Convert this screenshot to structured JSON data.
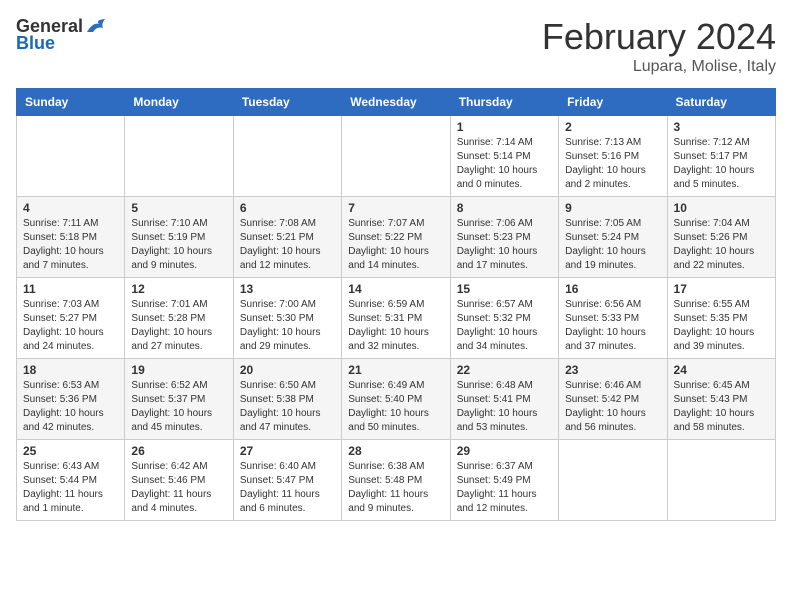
{
  "header": {
    "logo": {
      "general": "General",
      "blue": "Blue"
    },
    "title": "February 2024",
    "location": "Lupara, Molise, Italy"
  },
  "calendar": {
    "weekdays": [
      "Sunday",
      "Monday",
      "Tuesday",
      "Wednesday",
      "Thursday",
      "Friday",
      "Saturday"
    ],
    "weeks": [
      [
        {
          "day": "",
          "info": ""
        },
        {
          "day": "",
          "info": ""
        },
        {
          "day": "",
          "info": ""
        },
        {
          "day": "",
          "info": ""
        },
        {
          "day": "1",
          "info": "Sunrise: 7:14 AM\nSunset: 5:14 PM\nDaylight: 10 hours\nand 0 minutes."
        },
        {
          "day": "2",
          "info": "Sunrise: 7:13 AM\nSunset: 5:16 PM\nDaylight: 10 hours\nand 2 minutes."
        },
        {
          "day": "3",
          "info": "Sunrise: 7:12 AM\nSunset: 5:17 PM\nDaylight: 10 hours\nand 5 minutes."
        }
      ],
      [
        {
          "day": "4",
          "info": "Sunrise: 7:11 AM\nSunset: 5:18 PM\nDaylight: 10 hours\nand 7 minutes."
        },
        {
          "day": "5",
          "info": "Sunrise: 7:10 AM\nSunset: 5:19 PM\nDaylight: 10 hours\nand 9 minutes."
        },
        {
          "day": "6",
          "info": "Sunrise: 7:08 AM\nSunset: 5:21 PM\nDaylight: 10 hours\nand 12 minutes."
        },
        {
          "day": "7",
          "info": "Sunrise: 7:07 AM\nSunset: 5:22 PM\nDaylight: 10 hours\nand 14 minutes."
        },
        {
          "day": "8",
          "info": "Sunrise: 7:06 AM\nSunset: 5:23 PM\nDaylight: 10 hours\nand 17 minutes."
        },
        {
          "day": "9",
          "info": "Sunrise: 7:05 AM\nSunset: 5:24 PM\nDaylight: 10 hours\nand 19 minutes."
        },
        {
          "day": "10",
          "info": "Sunrise: 7:04 AM\nSunset: 5:26 PM\nDaylight: 10 hours\nand 22 minutes."
        }
      ],
      [
        {
          "day": "11",
          "info": "Sunrise: 7:03 AM\nSunset: 5:27 PM\nDaylight: 10 hours\nand 24 minutes."
        },
        {
          "day": "12",
          "info": "Sunrise: 7:01 AM\nSunset: 5:28 PM\nDaylight: 10 hours\nand 27 minutes."
        },
        {
          "day": "13",
          "info": "Sunrise: 7:00 AM\nSunset: 5:30 PM\nDaylight: 10 hours\nand 29 minutes."
        },
        {
          "day": "14",
          "info": "Sunrise: 6:59 AM\nSunset: 5:31 PM\nDaylight: 10 hours\nand 32 minutes."
        },
        {
          "day": "15",
          "info": "Sunrise: 6:57 AM\nSunset: 5:32 PM\nDaylight: 10 hours\nand 34 minutes."
        },
        {
          "day": "16",
          "info": "Sunrise: 6:56 AM\nSunset: 5:33 PM\nDaylight: 10 hours\nand 37 minutes."
        },
        {
          "day": "17",
          "info": "Sunrise: 6:55 AM\nSunset: 5:35 PM\nDaylight: 10 hours\nand 39 minutes."
        }
      ],
      [
        {
          "day": "18",
          "info": "Sunrise: 6:53 AM\nSunset: 5:36 PM\nDaylight: 10 hours\nand 42 minutes."
        },
        {
          "day": "19",
          "info": "Sunrise: 6:52 AM\nSunset: 5:37 PM\nDaylight: 10 hours\nand 45 minutes."
        },
        {
          "day": "20",
          "info": "Sunrise: 6:50 AM\nSunset: 5:38 PM\nDaylight: 10 hours\nand 47 minutes."
        },
        {
          "day": "21",
          "info": "Sunrise: 6:49 AM\nSunset: 5:40 PM\nDaylight: 10 hours\nand 50 minutes."
        },
        {
          "day": "22",
          "info": "Sunrise: 6:48 AM\nSunset: 5:41 PM\nDaylight: 10 hours\nand 53 minutes."
        },
        {
          "day": "23",
          "info": "Sunrise: 6:46 AM\nSunset: 5:42 PM\nDaylight: 10 hours\nand 56 minutes."
        },
        {
          "day": "24",
          "info": "Sunrise: 6:45 AM\nSunset: 5:43 PM\nDaylight: 10 hours\nand 58 minutes."
        }
      ],
      [
        {
          "day": "25",
          "info": "Sunrise: 6:43 AM\nSunset: 5:44 PM\nDaylight: 11 hours\nand 1 minute."
        },
        {
          "day": "26",
          "info": "Sunrise: 6:42 AM\nSunset: 5:46 PM\nDaylight: 11 hours\nand 4 minutes."
        },
        {
          "day": "27",
          "info": "Sunrise: 6:40 AM\nSunset: 5:47 PM\nDaylight: 11 hours\nand 6 minutes."
        },
        {
          "day": "28",
          "info": "Sunrise: 6:38 AM\nSunset: 5:48 PM\nDaylight: 11 hours\nand 9 minutes."
        },
        {
          "day": "29",
          "info": "Sunrise: 6:37 AM\nSunset: 5:49 PM\nDaylight: 11 hours\nand 12 minutes."
        },
        {
          "day": "",
          "info": ""
        },
        {
          "day": "",
          "info": ""
        }
      ]
    ]
  }
}
